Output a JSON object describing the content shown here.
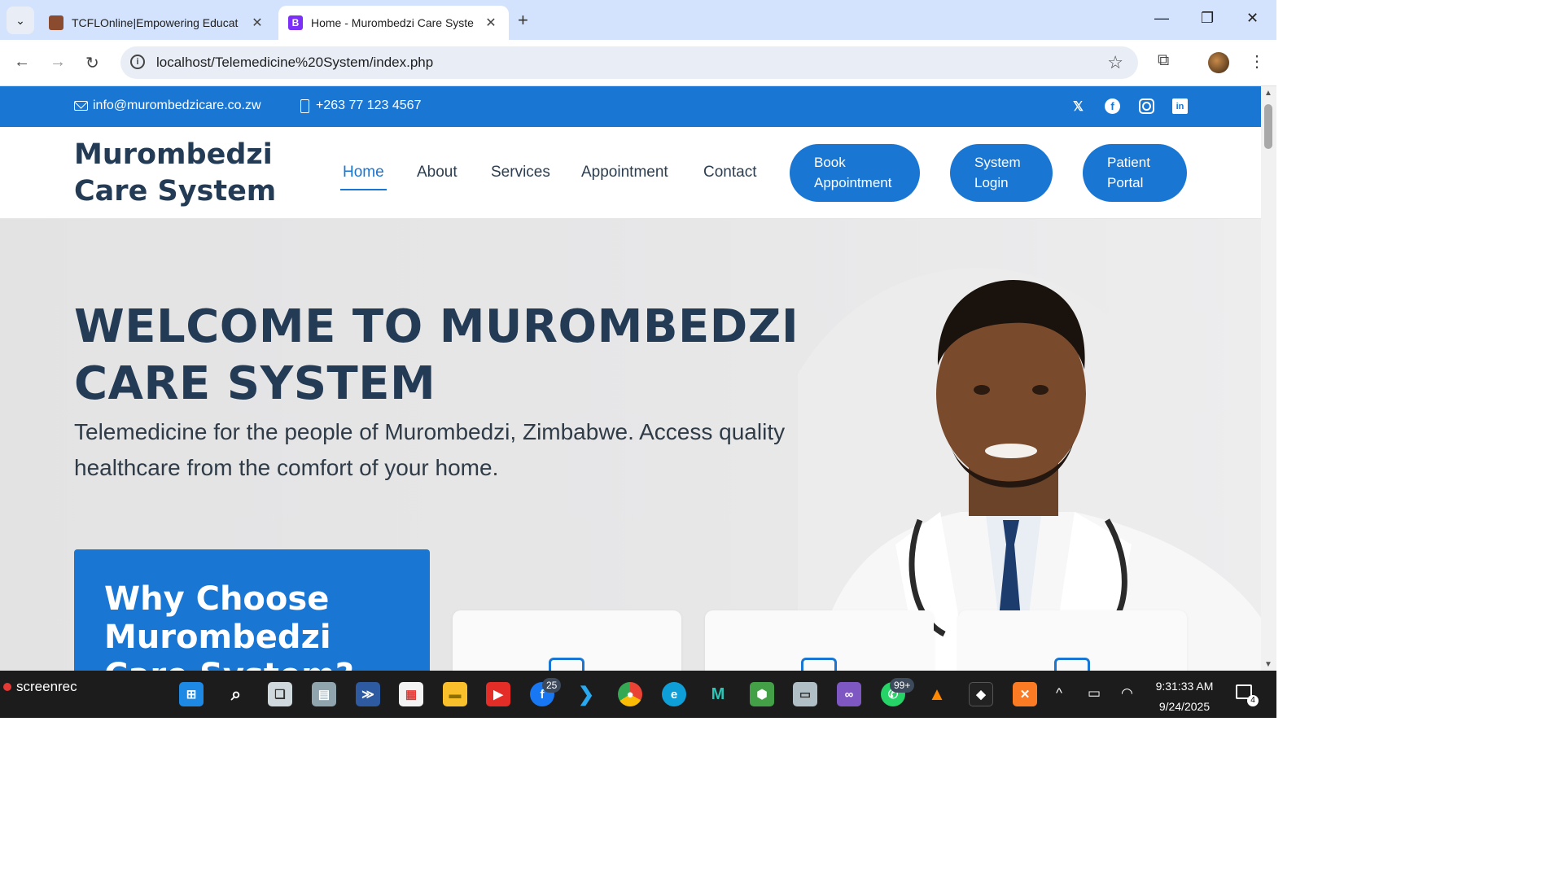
{
  "browser": {
    "tabs": [
      {
        "title": "TCFLOnline|Empowering Educat",
        "favicon_color": "#8a4b2e"
      },
      {
        "title": "Home - Murombedzi Care Syste",
        "favicon_letter": "B",
        "favicon_color": "#7b2ff7"
      }
    ],
    "url": "localhost/Telemedicine%20System/index.php"
  },
  "topbar": {
    "email": "info@murombedzicare.co.zw",
    "phone": "+263 77 123 4567",
    "social": [
      "x-icon",
      "facebook-icon",
      "instagram-icon",
      "linkedin-icon"
    ]
  },
  "header": {
    "logo": "Murombedzi Care System",
    "nav": [
      {
        "label": "Home",
        "active": true
      },
      {
        "label": "About"
      },
      {
        "label": "Services"
      },
      {
        "label": "Appointment"
      },
      {
        "label": "Contact"
      }
    ],
    "buttons": [
      "Book Appointment",
      "System Login",
      "Patient Portal"
    ]
  },
  "hero": {
    "title": "WELCOME TO MUROMBEDZI CARE SYSTEM",
    "subtitle": "Telemedicine for the people of Murombedzi, Zimbabwe. Access quality healthcare from the comfort of your home.",
    "why_title": "Why Choose Murombedzi Care System?"
  },
  "taskbar": {
    "recorder": "screenrec",
    "badges": [
      "25",
      "99+"
    ],
    "time": "9:31:33 AM",
    "date": "9/24/2025",
    "notifications": "4"
  },
  "colors": {
    "primary": "#1976d2",
    "heading": "#243b55"
  }
}
